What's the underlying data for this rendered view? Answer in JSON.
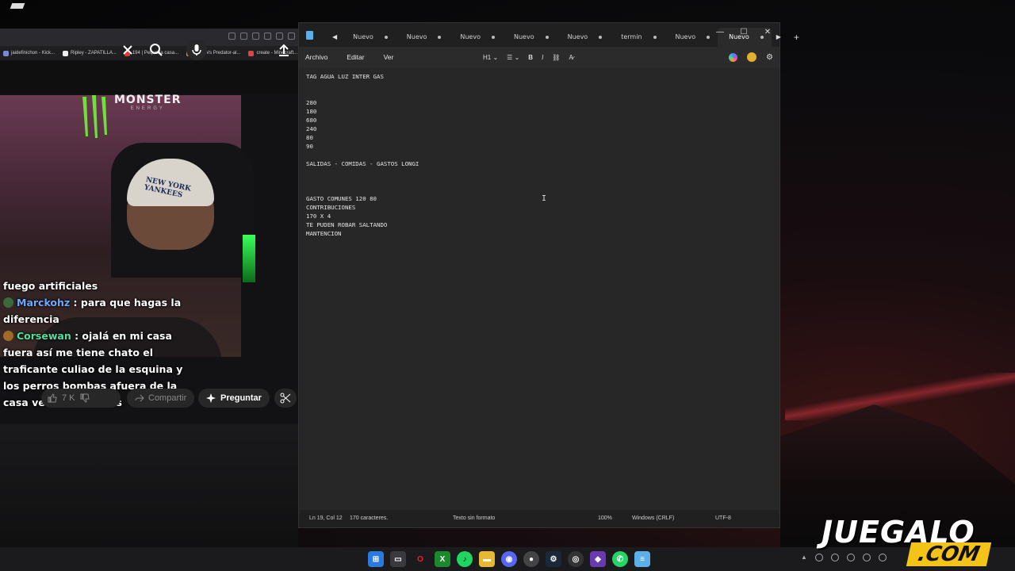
{
  "browser": {
    "bookmarks": [
      "jaidefinichon - Kick...",
      "Ripley - ZAPATILLA...",
      "194 | Pequeña casa...",
      "Alien Vs Predator-al...",
      "create - Minecraft..."
    ],
    "chat": [
      {
        "user": "",
        "text": "fuego artificiales"
      },
      {
        "user": "Marckohz",
        "text": " : para que hagas la diferencia"
      },
      {
        "user": "Corsewan",
        "text": " : ojalá en mi casa fuera así me tiene chato el traficante culiao de la esquina y los perros bombas afuera de la casa vendiendo weas"
      }
    ],
    "video_logo": {
      "brand": "MONSTER",
      "sub": "ENERGY"
    },
    "cap_text": "NEW YORK YANKEES",
    "like_count": "7 K",
    "share_label": "Compartir",
    "ask_label": "Preguntar"
  },
  "notepad": {
    "tabs": [
      {
        "label": "Nuevo",
        "active": false
      },
      {
        "label": "Nuevo",
        "active": false
      },
      {
        "label": "Nuevo",
        "active": false
      },
      {
        "label": "Nuevo",
        "active": false
      },
      {
        "label": "Nuevo",
        "active": false
      },
      {
        "label": "termin",
        "active": false
      },
      {
        "label": "Nuevo",
        "active": false
      },
      {
        "label": "Nuevo",
        "active": true
      }
    ],
    "menu": {
      "file": "Archivo",
      "edit": "Editar",
      "view": "Ver"
    },
    "heading_label": "H1",
    "lines": [
      "TAG AGUA LUZ INTER GAS",
      "",
      "",
      "280",
      "180",
      "680",
      "240",
      "80",
      "90",
      "",
      "SALIDAS - COMIDAS - GASTOS LONGI",
      "",
      "",
      "",
      "GASTO COMUNES 120 80",
      "CONTRIBUCIONES",
      "170 X 4",
      "TE PUDEN ROBAR SALTANDO",
      "MANTENCION"
    ],
    "status": {
      "position": "Ln 19, Col 12",
      "chars": "170 caracteres.",
      "format": "Texto sin formato",
      "zoom": "100%",
      "line_ending": "Windows (CRLF)",
      "encoding": "UTF-8"
    }
  },
  "watermark": {
    "top": "JUEGALO",
    "bottom": ".COM"
  },
  "colors": {
    "accent": "#f3c417",
    "notepad_bg": "#272727"
  }
}
